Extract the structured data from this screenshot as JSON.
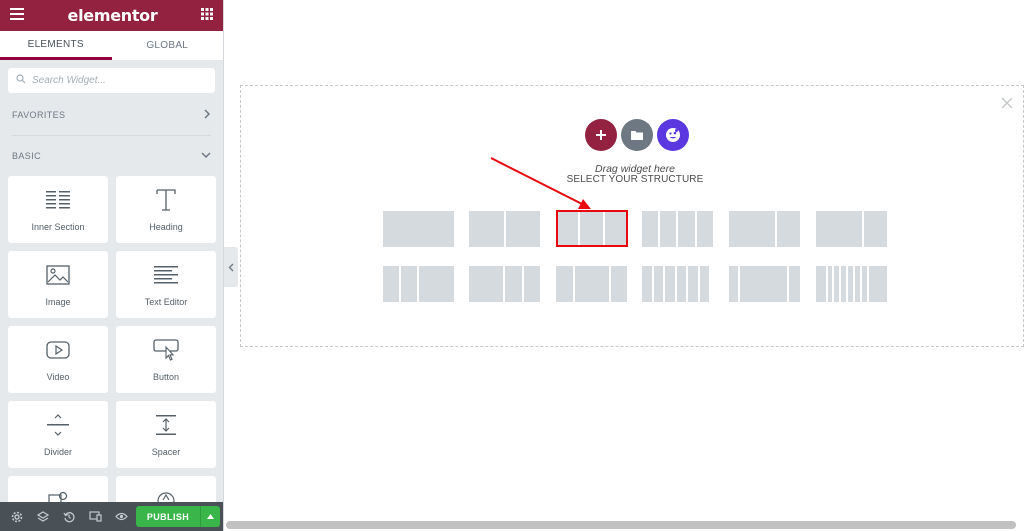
{
  "panel": {
    "logo": "elementor",
    "tabs": [
      {
        "label": "ELEMENTS",
        "active": true
      },
      {
        "label": "GLOBAL",
        "active": false
      }
    ],
    "search_placeholder": "Search Widget...",
    "categories": {
      "favorites": "FAVORITES",
      "basic": "BASIC"
    },
    "widgets": [
      {
        "label": "Inner Section",
        "icon": "inner-section-icon"
      },
      {
        "label": "Heading",
        "icon": "heading-icon"
      },
      {
        "label": "Image",
        "icon": "image-icon"
      },
      {
        "label": "Text Editor",
        "icon": "text-editor-icon"
      },
      {
        "label": "Video",
        "icon": "video-icon"
      },
      {
        "label": "Button",
        "icon": "button-icon"
      },
      {
        "label": "Divider",
        "icon": "divider-icon"
      },
      {
        "label": "Spacer",
        "icon": "spacer-icon"
      }
    ],
    "footer": {
      "publish_label": "PUBLISH"
    }
  },
  "canvas": {
    "drag_text": "Drag widget here",
    "select_text": "SELECT YOUR STRUCTURE",
    "structure_rows": [
      [
        "100",
        "50-50",
        "33-33-33",
        "25-25-25-25",
        "67-33",
        "33-67"
      ],
      [
        "25-75",
        "50-25-25",
        "25-50-25",
        "16x6",
        "25-50-25 wide",
        "10-rich"
      ]
    ],
    "highlighted_structure": "33-33-33"
  },
  "colors": {
    "brand": "#92223f",
    "publish": "#39b54a",
    "add_circle": "#92223f",
    "template_circle": "#6d7882",
    "kit_circle": "#5b37e0",
    "annotation": "#e8090f"
  }
}
